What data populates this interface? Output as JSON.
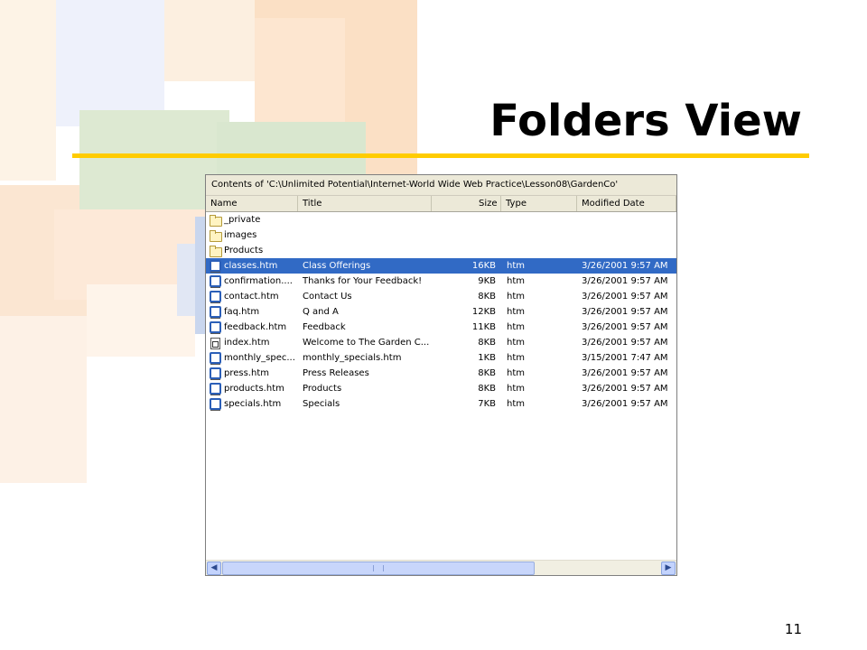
{
  "slide": {
    "title": "Folders View",
    "page_number": "11",
    "accent_color": "#ffcc00"
  },
  "explorer": {
    "path_label": "Contents of 'C:\\Unlimited Potential\\Internet-World Wide Web Practice\\Lesson08\\GardenCo'",
    "columns": {
      "name": "Name",
      "title": "Title",
      "size": "Size",
      "type": "Type",
      "modified": "Modified Date"
    },
    "rows": [
      {
        "icon": "folder-icon",
        "name": "_private",
        "title": "",
        "size": "",
        "type": "",
        "modified": ""
      },
      {
        "icon": "folder-icon",
        "name": "images",
        "title": "",
        "size": "",
        "type": "",
        "modified": ""
      },
      {
        "icon": "folder-icon",
        "name": "Products",
        "title": "",
        "size": "",
        "type": "",
        "modified": ""
      },
      {
        "icon": "page-icon",
        "name": "classes.htm",
        "title": "Class Offerings",
        "size": "16KB",
        "type": "htm",
        "modified": "3/26/2001 9:57 AM",
        "selected": true
      },
      {
        "icon": "page-icon",
        "name": "confirmation....",
        "title": "Thanks for Your Feedback!",
        "size": "9KB",
        "type": "htm",
        "modified": "3/26/2001 9:57 AM"
      },
      {
        "icon": "page-icon",
        "name": "contact.htm",
        "title": "Contact Us",
        "size": "8KB",
        "type": "htm",
        "modified": "3/26/2001 9:57 AM"
      },
      {
        "icon": "page-icon",
        "name": "faq.htm",
        "title": "Q and A",
        "size": "12KB",
        "type": "htm",
        "modified": "3/26/2001 9:57 AM"
      },
      {
        "icon": "page-icon",
        "name": "feedback.htm",
        "title": "Feedback",
        "size": "11KB",
        "type": "htm",
        "modified": "3/26/2001 9:57 AM"
      },
      {
        "icon": "home-icon",
        "name": "index.htm",
        "title": "Welcome to The Garden C...",
        "size": "8KB",
        "type": "htm",
        "modified": "3/26/2001 9:57 AM"
      },
      {
        "icon": "page-icon",
        "name": "monthly_spec...",
        "title": "monthly_specials.htm",
        "size": "1KB",
        "type": "htm",
        "modified": "3/15/2001 7:47 AM"
      },
      {
        "icon": "page-icon",
        "name": "press.htm",
        "title": "Press Releases",
        "size": "8KB",
        "type": "htm",
        "modified": "3/26/2001 9:57 AM"
      },
      {
        "icon": "page-icon",
        "name": "products.htm",
        "title": "Products",
        "size": "8KB",
        "type": "htm",
        "modified": "3/26/2001 9:57 AM"
      },
      {
        "icon": "page-icon",
        "name": "specials.htm",
        "title": "Specials",
        "size": "7KB",
        "type": "htm",
        "modified": "3/26/2001 9:57 AM"
      }
    ],
    "selection_color": "#316ac5"
  }
}
